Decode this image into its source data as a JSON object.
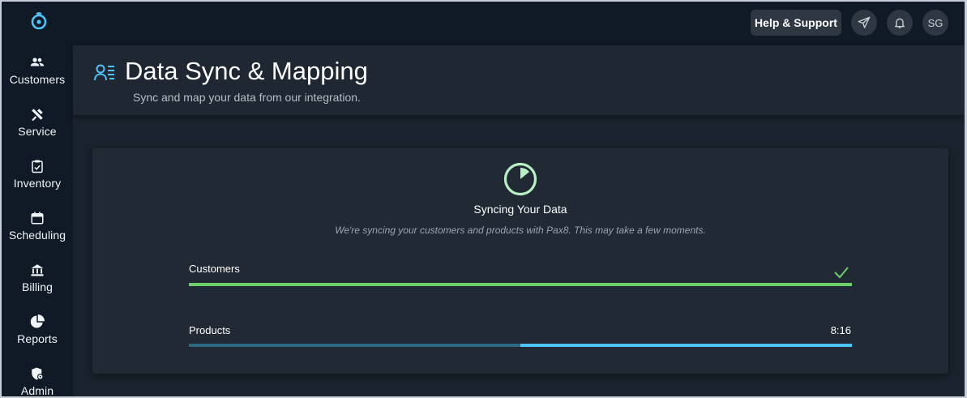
{
  "sidebar": {
    "items": [
      {
        "label": "Customers",
        "icon": "customers-icon"
      },
      {
        "label": "Service",
        "icon": "tools-icon"
      },
      {
        "label": "Inventory",
        "icon": "clipboard-check-icon"
      },
      {
        "label": "Scheduling",
        "icon": "calendar-icon"
      },
      {
        "label": "Billing",
        "icon": "bank-icon"
      },
      {
        "label": "Reports",
        "icon": "pie-chart-icon"
      },
      {
        "label": "Admin",
        "icon": "shield-gear-icon"
      }
    ]
  },
  "topbar": {
    "help_label": "Help & Support",
    "avatar_initials": "SG"
  },
  "header": {
    "title": "Data Sync & Mapping",
    "subtitle": "Sync and map your data from our integration."
  },
  "sync": {
    "title": "Syncing Your Data",
    "description": "We're syncing your customers and products with Pax8. This may take a few moments.",
    "rows": [
      {
        "label": "Customers",
        "progress": 1.0,
        "status": "complete"
      },
      {
        "label": "Products",
        "time": "8:16",
        "progress": 0.5,
        "progress_from": 0.5
      }
    ]
  },
  "colors": {
    "accent": "#4fc3f7",
    "success": "#6ccf6a",
    "sidebar_bg": "#0f1a26",
    "card_bg": "#212935"
  }
}
